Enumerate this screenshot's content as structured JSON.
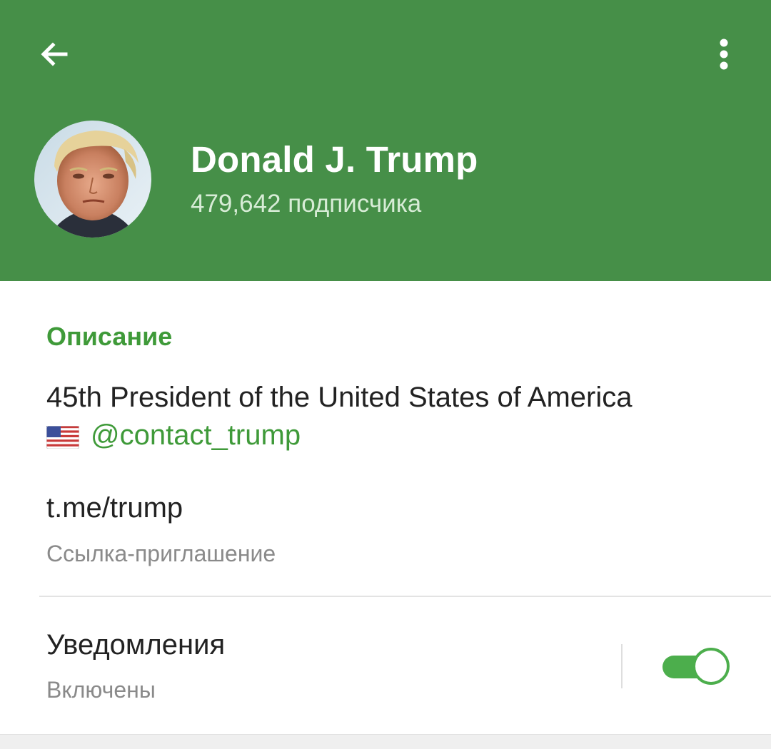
{
  "header": {
    "background_color": "#468f48",
    "back_icon": "arrow-left-icon",
    "menu_icon": "more-vertical-icon",
    "channel_name": "Donald J. Trump",
    "subscribers": "479,642 подписчика"
  },
  "description": {
    "section_title": "Описание",
    "line1": "45th President of the United States of America",
    "flag_icon": "us-flag-icon",
    "mention": "@contact_trump",
    "accent_color": "#3f9a39"
  },
  "invite_link": {
    "link": "t.me/trump",
    "caption": "Ссылка-приглашение"
  },
  "notifications": {
    "title": "Уведомления",
    "status": "Включены",
    "enabled": true,
    "toggle_color": "#4cae4c"
  }
}
